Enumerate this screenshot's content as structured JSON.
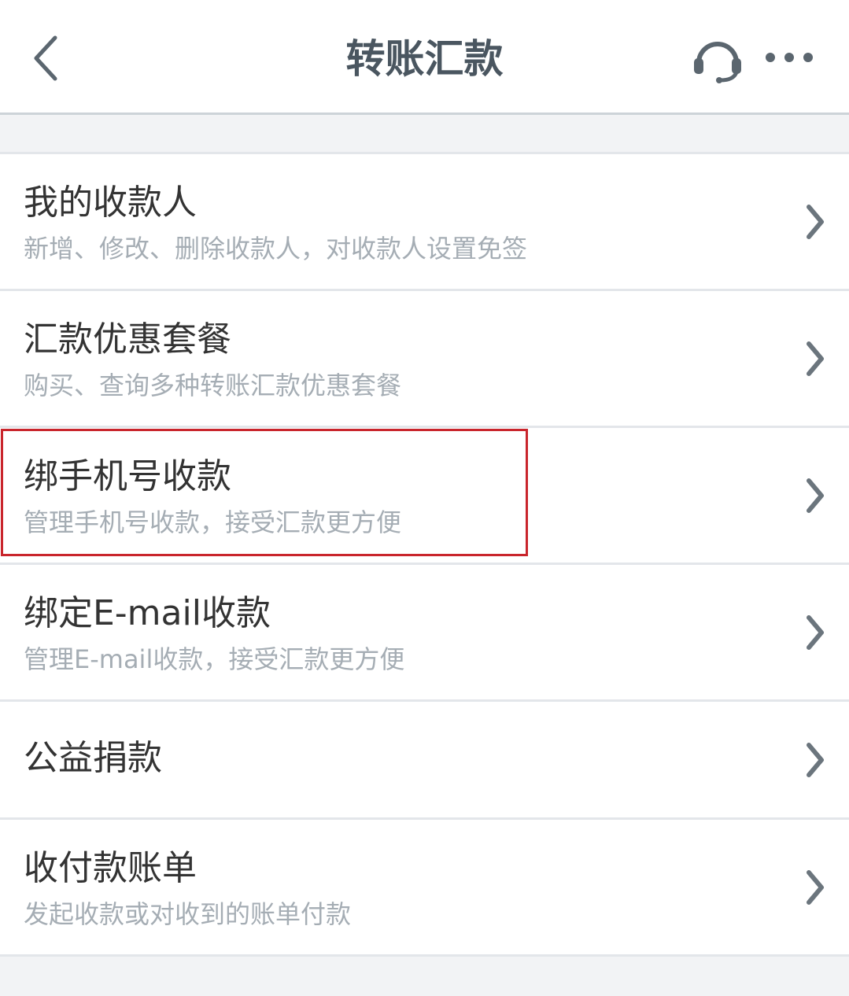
{
  "header": {
    "title": "转账汇款",
    "back_icon": "chevron-left-icon",
    "service_icon": "headset-icon",
    "more_icon": "more-dots-icon"
  },
  "menu": {
    "items": [
      {
        "title": "我的收款人",
        "desc": "新增、修改、删除收款人，对收款人设置免签"
      },
      {
        "title": "汇款优惠套餐",
        "desc": "购买、查询多种转账汇款优惠套餐"
      },
      {
        "title": "绑手机号收款",
        "desc": "管理手机号收款，接受汇款更方便"
      },
      {
        "title": "绑定E-mail收款",
        "desc": "管理E-mail收款，接受汇款更方便"
      },
      {
        "title": "公益捐款"
      },
      {
        "title": "收付款账单",
        "desc": "发起收款或对收到的账单付款"
      }
    ],
    "chevron_icon": "chevron-right-icon"
  },
  "colors": {
    "header_title": "#4a5660",
    "item_title": "#333333",
    "item_desc": "#a5adb4",
    "highlight": "#c9252c",
    "page_background": "#f2f3f5"
  }
}
